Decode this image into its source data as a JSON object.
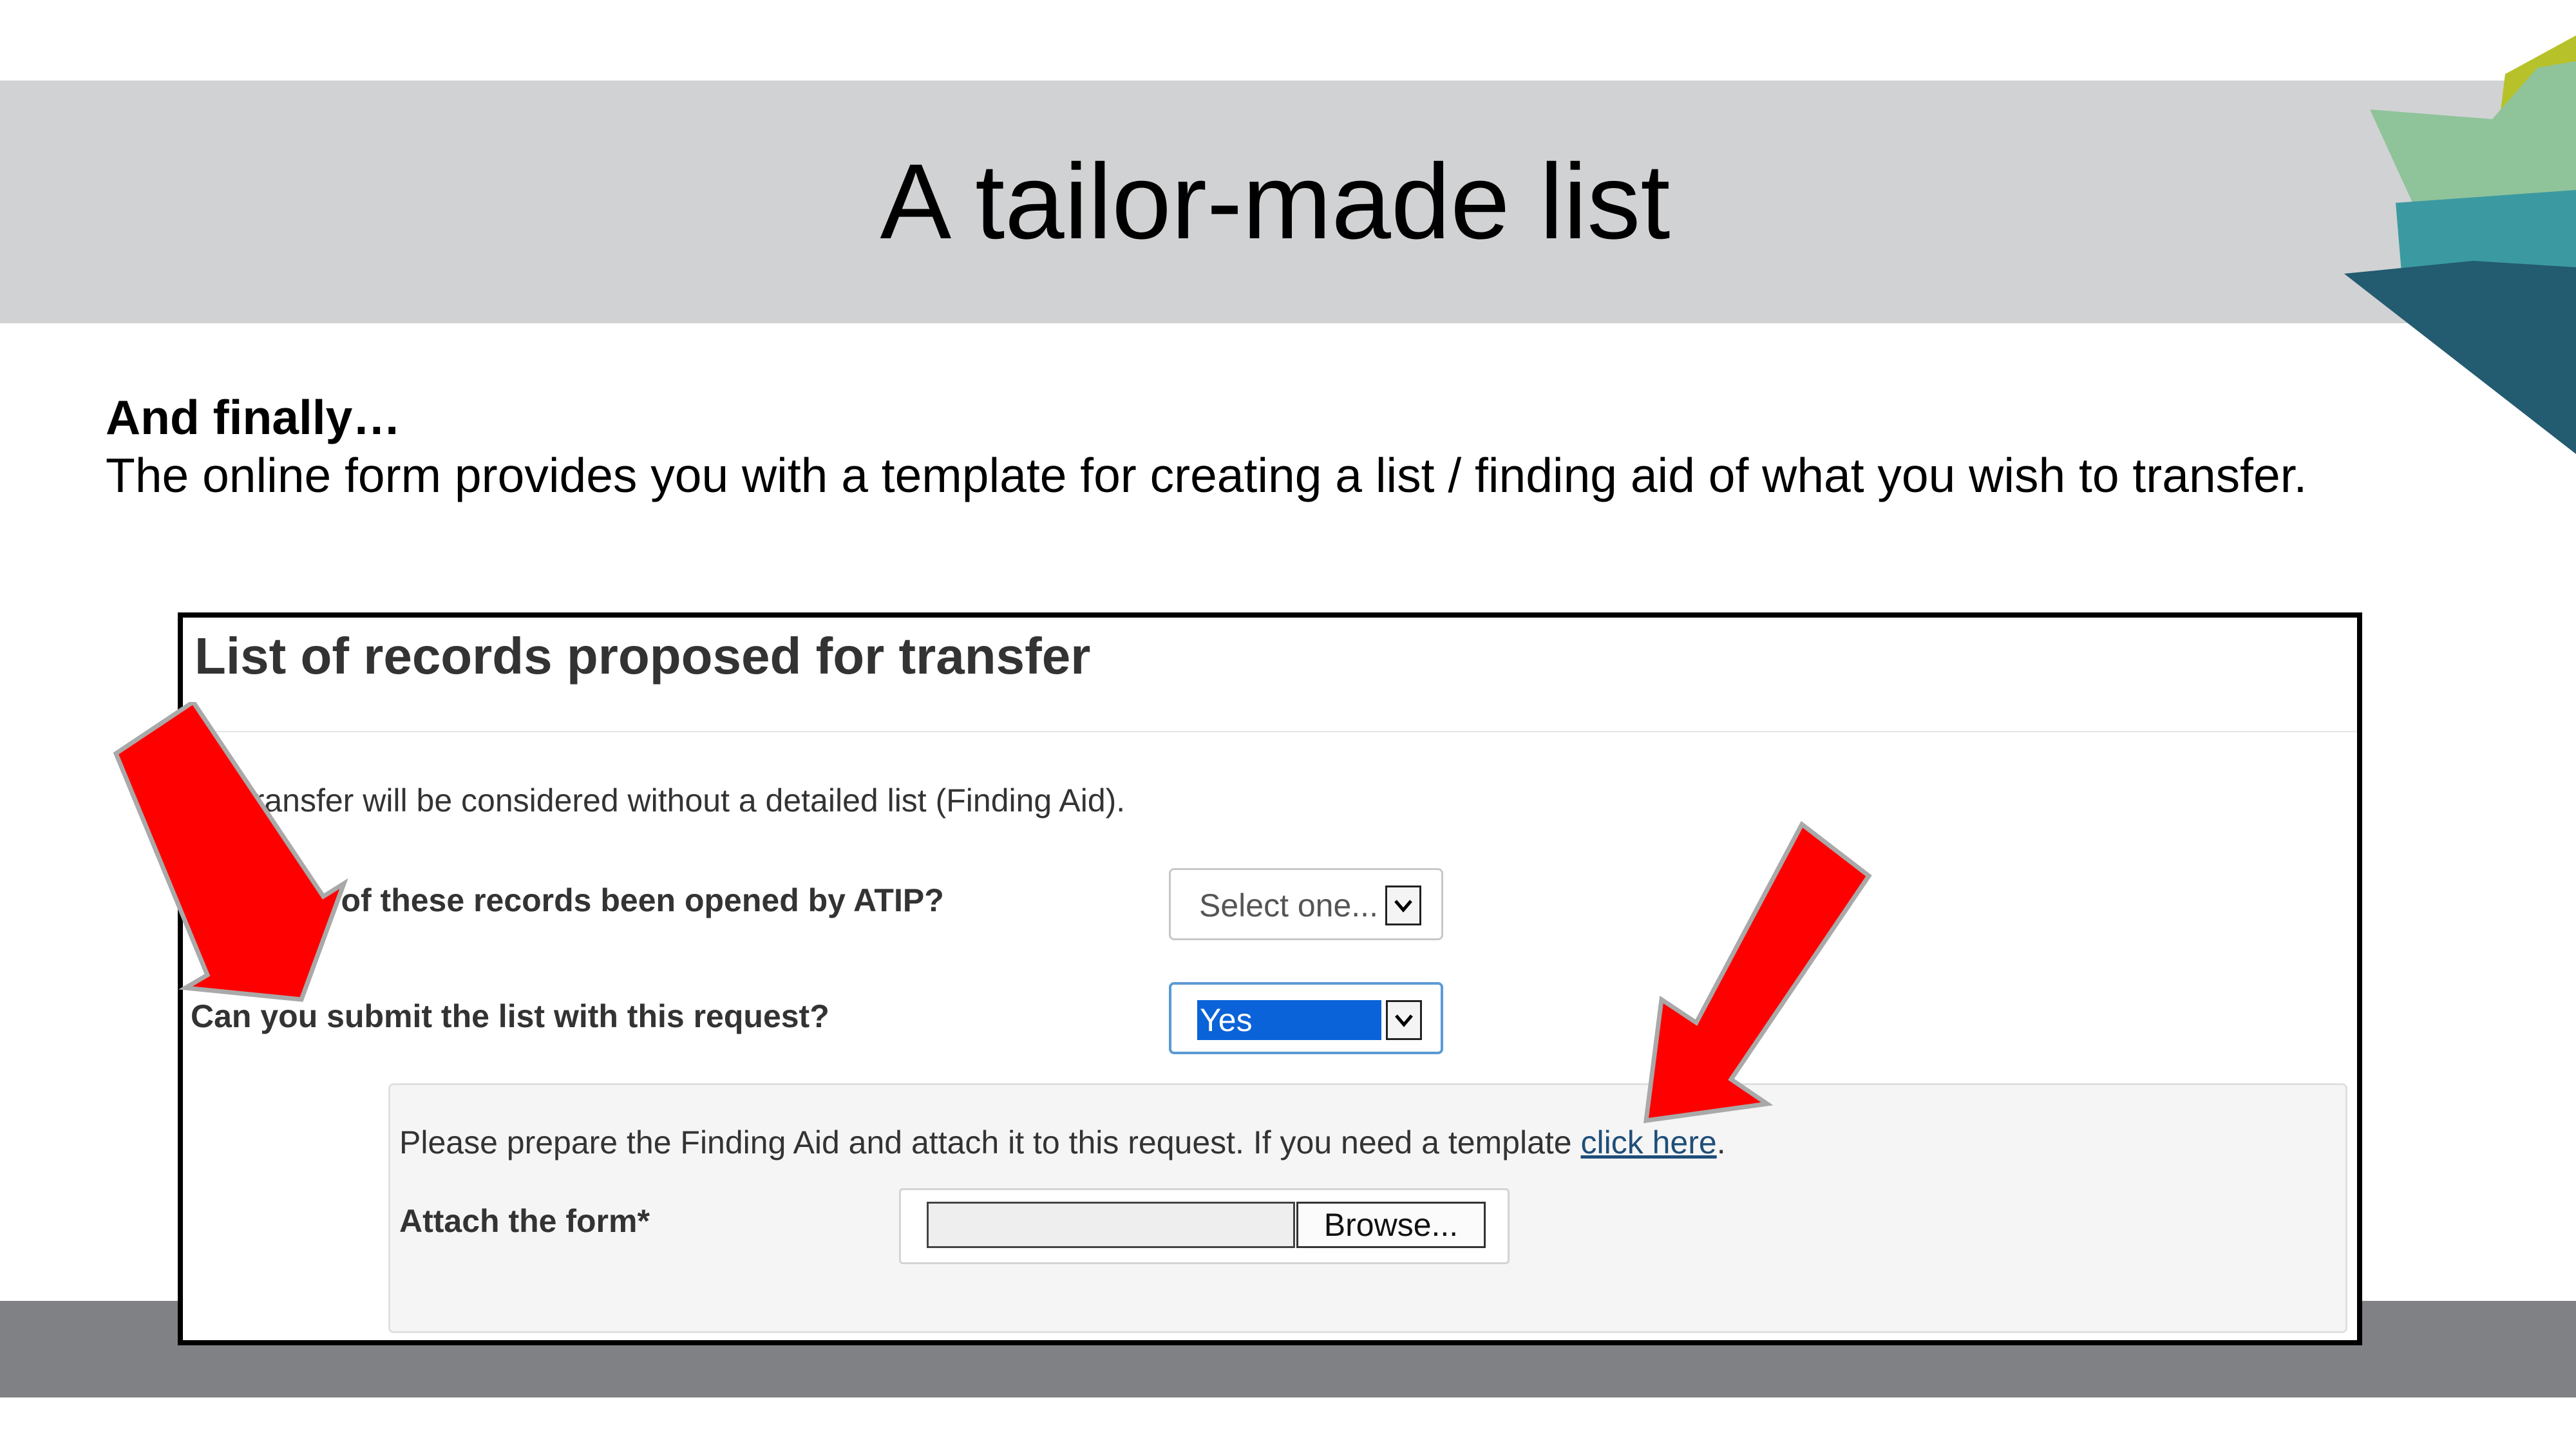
{
  "slide": {
    "title": "A tailor-made list",
    "intro_heading": "And finally…",
    "intro_text": "The online form provides you with a template for creating a list / finding aid of what you wish to transfer."
  },
  "form": {
    "title": "List of records proposed for transfer",
    "notice": "No transfer will be considered without a detailed list (Finding Aid).",
    "questions": [
      {
        "label": "Have any of these records been opened by ATIP?",
        "select_value": "Select one..."
      },
      {
        "label": "Can you submit the list with this request?",
        "select_value": "Yes"
      }
    ],
    "finding_aid": {
      "text": "Please prepare the Finding Aid and attach it to this request. If you need a template ",
      "link": "click here",
      "trailing": ".",
      "attach_label": "Attach the form*",
      "browse_label": "Browse..."
    }
  },
  "icons": [
    "dropdown-arrow-icon",
    "red-arrow-icon",
    "corner-leaf-decoration"
  ],
  "colors": {
    "title_band": "#d1d2d4",
    "footer_band": "#808184",
    "highlight": "#0a63d8",
    "arrow": "#ff0000",
    "link": "#1f4e79"
  }
}
